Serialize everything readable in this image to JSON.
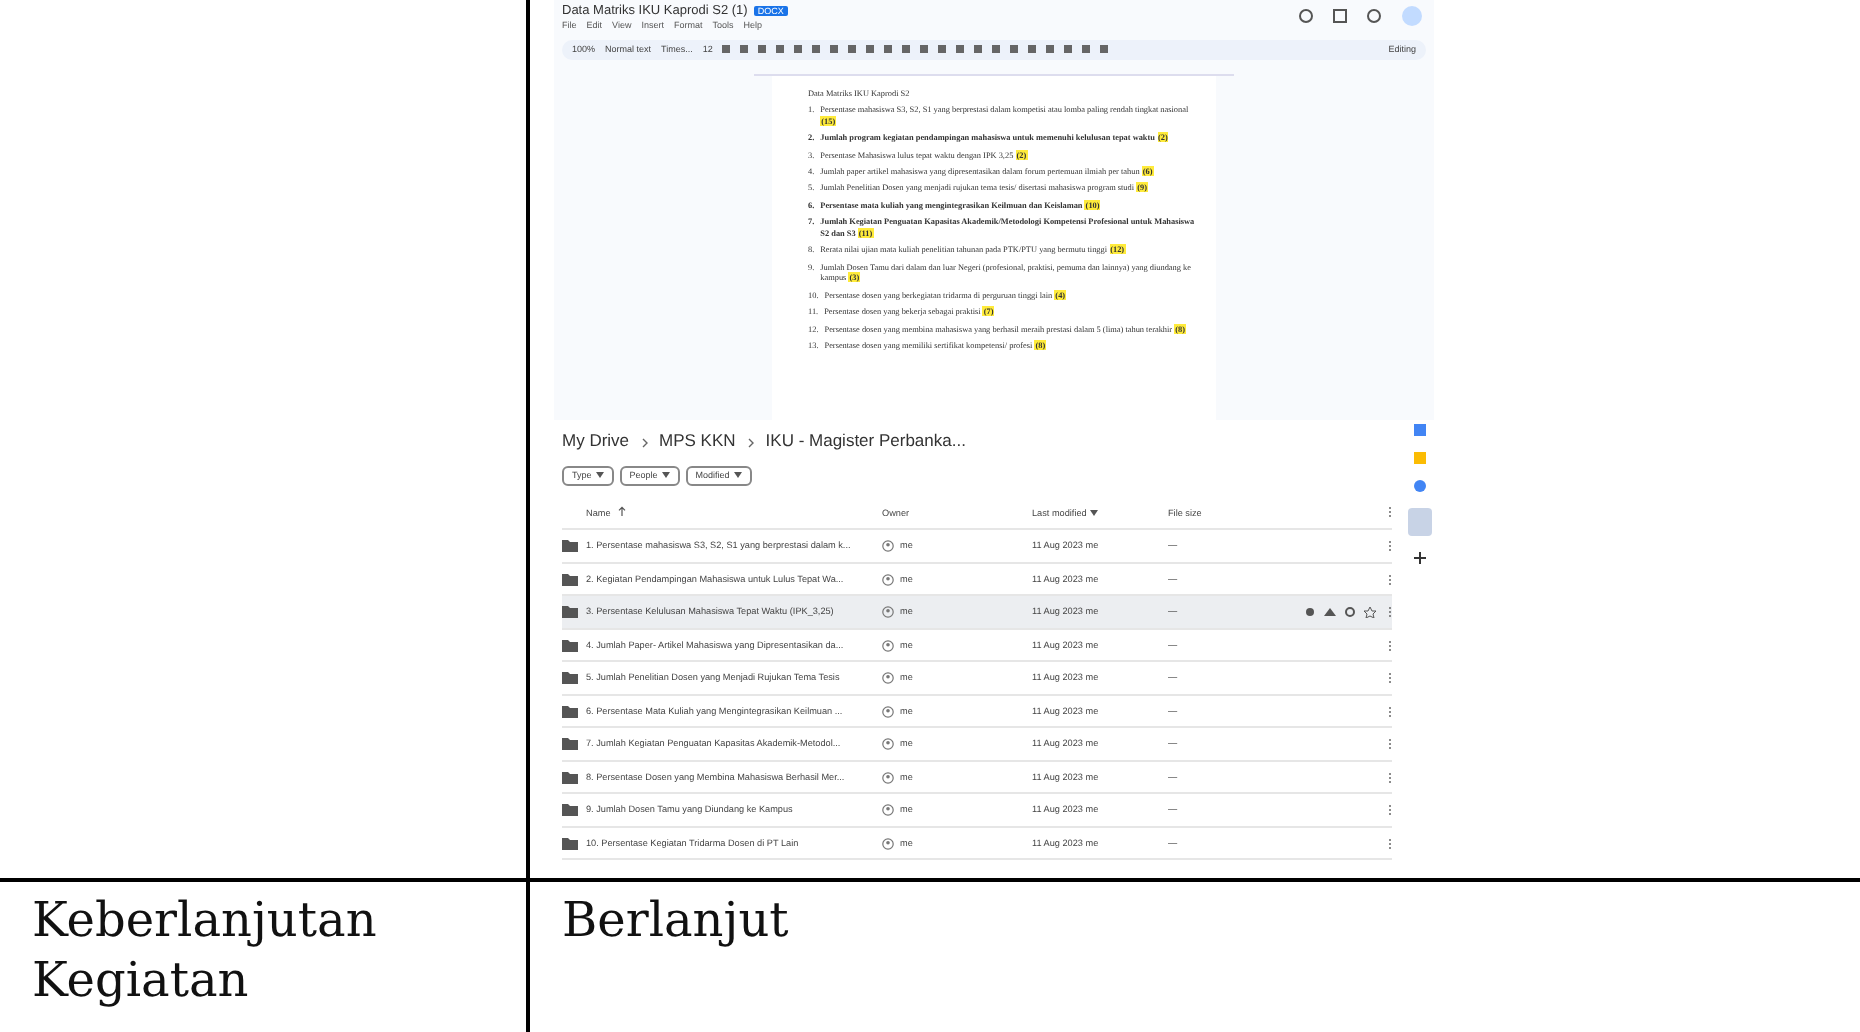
{
  "doc_screenshot": {
    "title": "Data Matriks IKU Kaprodi S2 (1)",
    "badge": "DOCX",
    "menu": [
      "File",
      "Edit",
      "View",
      "Insert",
      "Format",
      "Tools",
      "Help"
    ],
    "zoom": "100%",
    "style": "Normal text",
    "font": "Times...",
    "font_size": "12",
    "editing": "Editing",
    "heading": "Data Matriks IKU Kaprodi S2",
    "items": [
      {
        "text": "Persentase mahasiswa S3, S2, S1 yang berprestasi dalam kompetisi atau lomba paling rendah tingkat nasional",
        "tag": "(15)",
        "num": "1.",
        "bold": false
      },
      {
        "text": "Jumlah program kegiatan pendampingan mahasiswa untuk memenuhi kelulusan tepat waktu",
        "tag": "(2)",
        "num": "2.",
        "bold": true
      },
      {
        "text": "Persentase Mahasiswa lulus tepat waktu dengan IPK 3,25",
        "tag": "(2)",
        "num": "3.",
        "bold": false
      },
      {
        "text": "Jumlah paper artikel mahasiswa yang dipresentasikan dalam forum pertemuan ilmiah per tahun",
        "tag": "(6)",
        "num": "4.",
        "bold": false
      },
      {
        "text": "Jumlah Penelitian Dosen yang menjadi rujukan tema tesis/ disertasi mahasiswa program studi",
        "tag": "(9)",
        "num": "5.",
        "bold": false
      },
      {
        "text": "Persentase mata kuliah yang mengintegrasikan Keilmuan dan Keislaman",
        "tag": "(10)",
        "num": "6.",
        "bold": true
      },
      {
        "text": "Jumlah Kegiatan Penguatan Kapasitas Akademik/Metodologi Kompetensi Profesional untuk Mahasiswa S2 dan S3",
        "tag": "(11)",
        "num": "7.",
        "bold": true
      },
      {
        "text": "Rerata nilai ujian mata kuliah penelitian tahunan pada PTK/PTU yang bermutu tinggi",
        "tag": "(12)",
        "num": "8.",
        "bold": false
      },
      {
        "text": "Jumlah Dosen Tamu dari dalam dan luar Negeri (profesional, praktisi, pemuma dan lainnya) yang diundang ke kampus",
        "tag": "(3)",
        "num": "9.",
        "bold": false
      },
      {
        "text": "Persentase dosen yang berkegiatan tridarma di perguruan tinggi lain",
        "tag": "(4)",
        "num": "10.",
        "bold": false
      },
      {
        "text": "Persentase dosen yang bekerja sebagai praktisi",
        "tag": "(7)",
        "num": "11.",
        "bold": false
      },
      {
        "text": "Persentase dosen yang membina mahasiswa yang berhasil meraih prestasi dalam 5 (lima) tahun terakhir",
        "tag": "(8)",
        "num": "12.",
        "bold": false
      },
      {
        "text": "Persentase dosen yang memiliki sertifikat kompetensi/ profesi",
        "tag": "(8)",
        "num": "13.",
        "bold": false
      }
    ]
  },
  "drive_screenshot": {
    "breadcrumb": [
      "My Drive",
      "MPS KKN",
      "IKU - Magister Perbanka..."
    ],
    "filters": [
      "Type",
      "People",
      "Modified"
    ],
    "columns": [
      "Name",
      "Owner",
      "Last modified",
      "File size"
    ],
    "rows": [
      {
        "name": "1. Persentase mahasiswa S3, S2, S1 yang berprestasi dalam k...",
        "owner": "me",
        "modified": "11 Aug 2023 me",
        "size": "—",
        "selected": false
      },
      {
        "name": "2. Kegiatan Pendampingan Mahasiswa untuk Lulus Tepat Wa...",
        "owner": "me",
        "modified": "11 Aug 2023 me",
        "size": "—",
        "selected": false
      },
      {
        "name": "3. Persentase Kelulusan Mahasiswa Tepat Waktu (IPK_3,25)",
        "owner": "me",
        "modified": "11 Aug 2023 me",
        "size": "—",
        "selected": true
      },
      {
        "name": "4. Jumlah Paper- Artikel Mahasiswa yang Dipresentasikan da...",
        "owner": "me",
        "modified": "11 Aug 2023 me",
        "size": "—",
        "selected": false
      },
      {
        "name": "5. Jumlah Penelitian Dosen yang Menjadi Rujukan Tema Tesis",
        "owner": "me",
        "modified": "11 Aug 2023 me",
        "size": "—",
        "selected": false
      },
      {
        "name": "6. Persentase Mata Kuliah yang Mengintegrasikan Keilmuan ...",
        "owner": "me",
        "modified": "11 Aug 2023 me",
        "size": "—",
        "selected": false
      },
      {
        "name": "7. Jumlah Kegiatan Penguatan Kapasitas Akademik-Metodol...",
        "owner": "me",
        "modified": "11 Aug 2023 me",
        "size": "—",
        "selected": false
      },
      {
        "name": "8. Persentase Dosen yang Membina Mahasiswa Berhasil Mer...",
        "owner": "me",
        "modified": "11 Aug 2023 me",
        "size": "—",
        "selected": false
      },
      {
        "name": "9. Jumlah Dosen Tamu yang Diundang ke Kampus",
        "owner": "me",
        "modified": "11 Aug 2023 me",
        "size": "—",
        "selected": false
      },
      {
        "name": "10. Persentase Kegiatan Tridarma Dosen di PT Lain",
        "owner": "me",
        "modified": "11 Aug 2023 me",
        "size": "—",
        "selected": false
      }
    ]
  },
  "table": {
    "label": "Keberlanjutan Kegiatan",
    "value": "Berlanjut"
  }
}
